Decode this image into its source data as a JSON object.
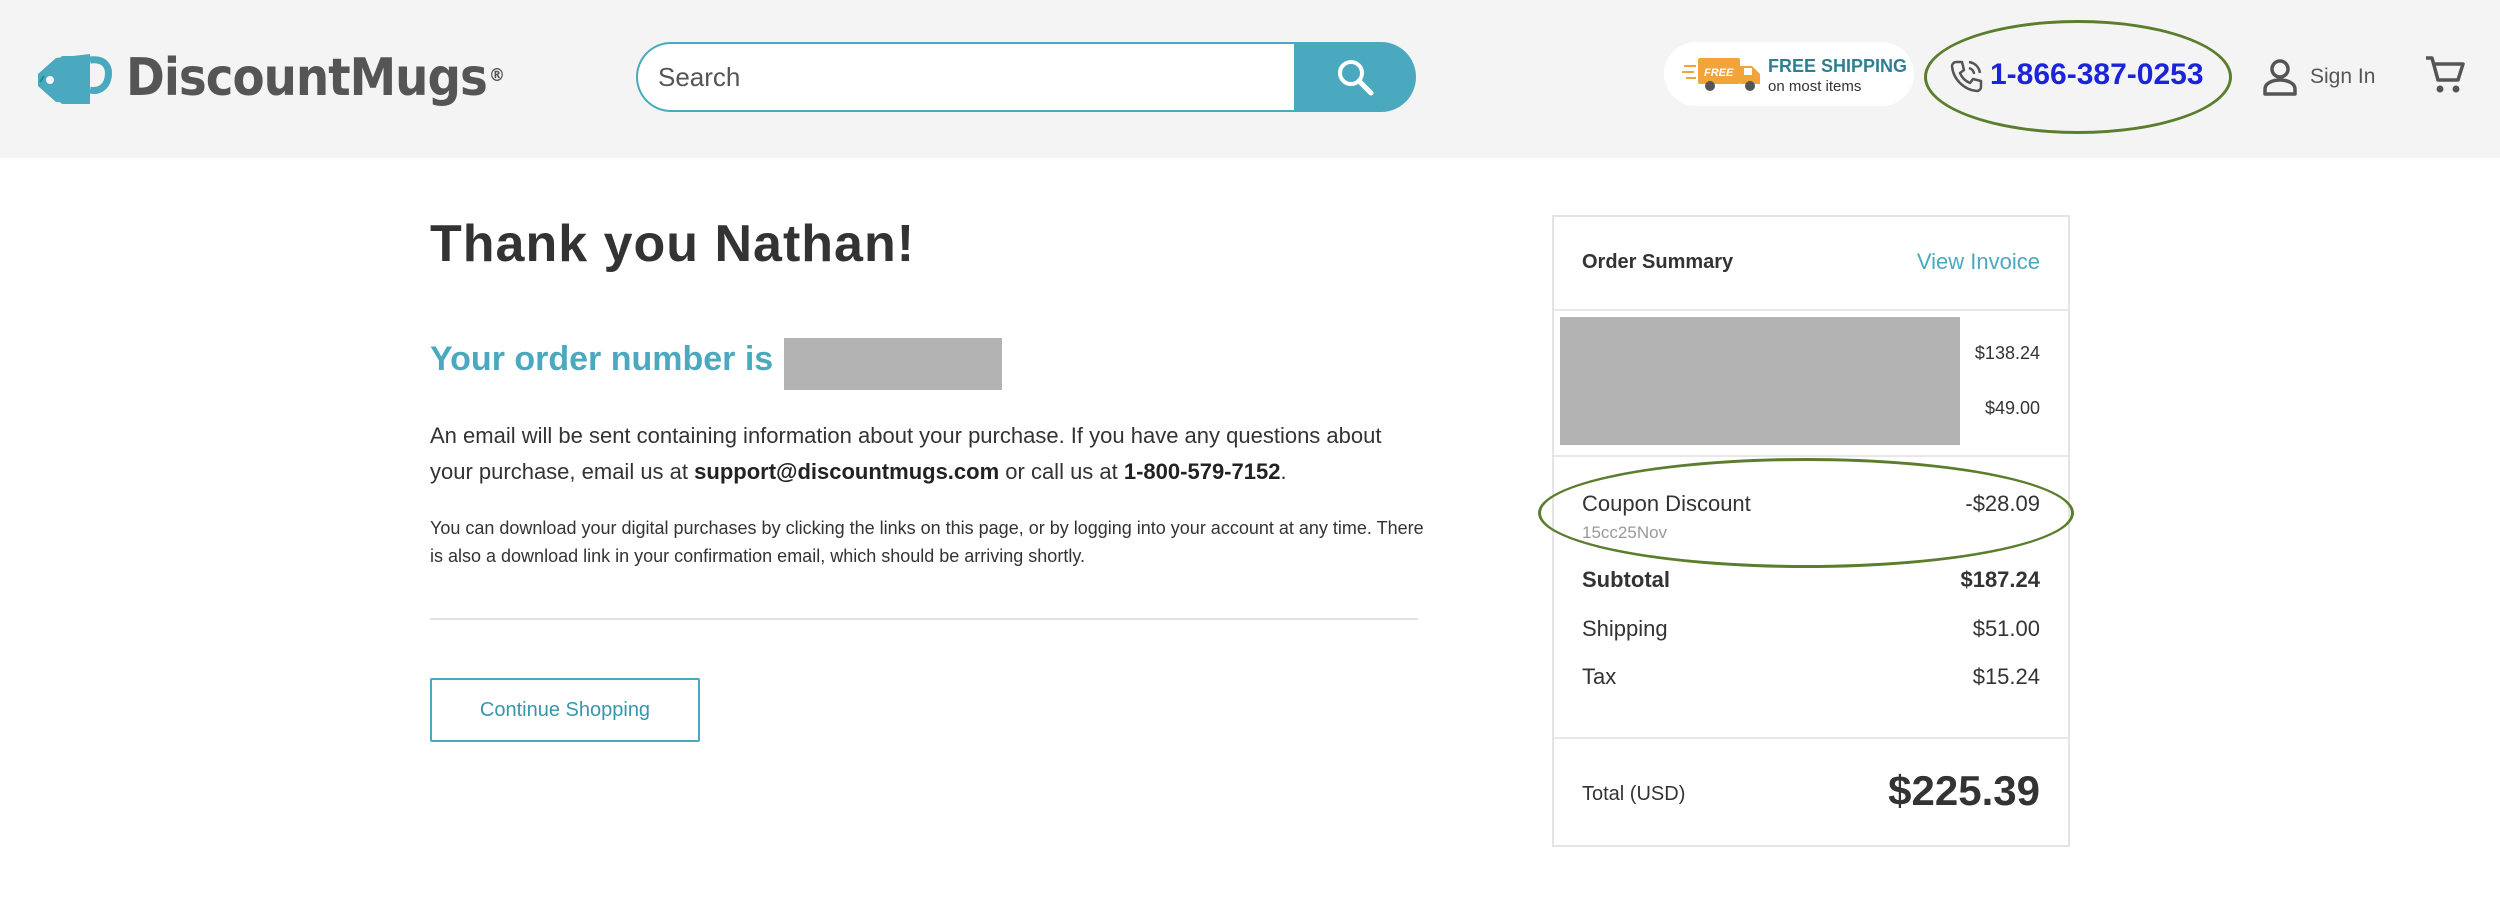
{
  "header": {
    "logo": {
      "brand_light": "Discount",
      "brand_bold": "Mugs",
      "registered": "®"
    },
    "search": {
      "placeholder": "Search"
    },
    "free_shipping": {
      "badge": "FREE",
      "title": "FREE SHIPPING",
      "subtitle": "on most items"
    },
    "phone": "1-866-387-0253",
    "sign_in": "Sign In"
  },
  "main": {
    "thanks": "Thank you Nathan!",
    "order_number_label": "Your order number is",
    "email_text_1": "An email will be sent containing information about your purchase. If you have any questions about your purchase, email us at ",
    "support_email": "support@discountmugs.com",
    "email_text_2": " or call us at ",
    "support_phone": "1-800-579-7152",
    "email_text_3": ".",
    "download_text": "You can download your digital purchases by clicking the links on this page, or by logging into your account at any time. There is also a download link in your confirmation email, which should be arriving shortly.",
    "continue_label": "Continue Shopping"
  },
  "summary": {
    "title": "Order Summary",
    "view_invoice": "View Invoice",
    "item_prices": [
      "$138.24",
      "$49.00"
    ],
    "coupon_label": "Coupon Discount",
    "coupon_code": "15cc25Nov",
    "coupon_value": "-$28.09",
    "subtotal_label": "Subtotal",
    "subtotal_value": "$187.24",
    "shipping_label": "Shipping",
    "shipping_value": "$51.00",
    "tax_label": "Tax",
    "tax_value": "$15.24",
    "total_label": "Total (USD)",
    "total_value": "$225.39"
  },
  "colors": {
    "accent": "#4aa9bf",
    "phone": "#1b24d8",
    "annotation": "#5b7d2e",
    "header_bg": "#f4f4f4",
    "redaction": "#b3b3b3"
  },
  "icons": [
    "mug-tag-icon",
    "search-icon",
    "delivery-truck-icon",
    "phone-icon",
    "user-icon",
    "cart-icon"
  ]
}
